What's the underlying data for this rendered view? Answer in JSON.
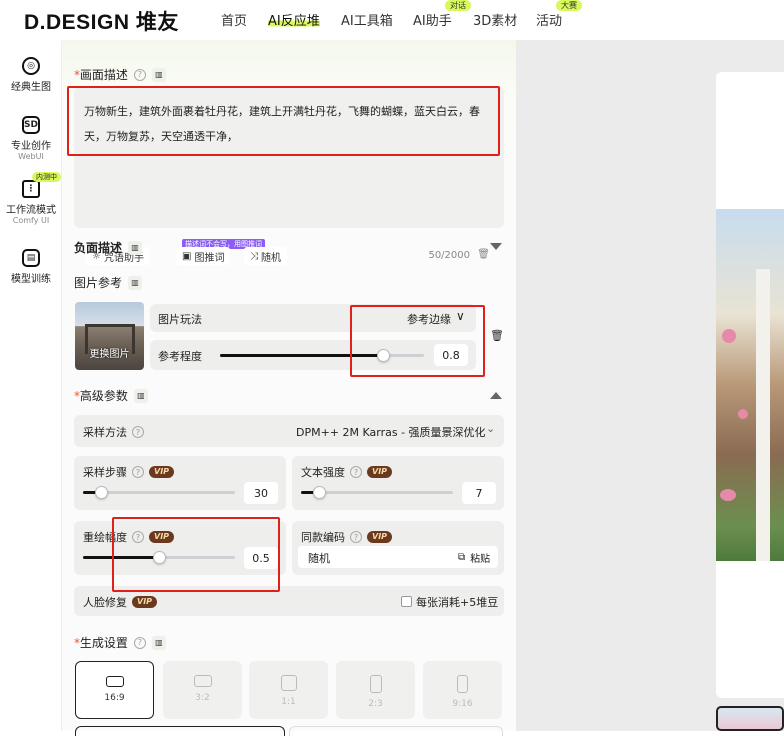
{
  "brand": {
    "logo_text": "D.DESIGN 堆友"
  },
  "nav": {
    "items": [
      {
        "label": "首页"
      },
      {
        "label": "AI反应堆"
      },
      {
        "label": "AI工具箱"
      },
      {
        "label": "AI助手",
        "badge": "对话"
      },
      {
        "label": "3D素材"
      },
      {
        "label": "活动",
        "badge": "大赛"
      }
    ]
  },
  "rail": {
    "items": [
      {
        "label": "经典生图",
        "icon": "palette-icon"
      },
      {
        "label": "专业创作",
        "sub": "WebUI",
        "icon": "sd-icon",
        "icon_text": "SD"
      },
      {
        "label": "工作流模式",
        "sub": "Comfy UI",
        "badge": "内测中",
        "icon": "workflow-icon"
      },
      {
        "label": "模型训练",
        "icon": "model-icon"
      }
    ]
  },
  "prompt": {
    "title": "画面描述",
    "text": "万物新生，建筑外面裹着牡丹花，建筑上开满牡丹花，飞舞的蝴蝶，蓝天白云，春天，万物复苏，天空通透干净，",
    "tools": {
      "assistant": "咒语助手",
      "img2prompt": "图推词",
      "random": "随机",
      "tip": "描述词不会写，用图推词"
    },
    "counter": "50/2000"
  },
  "negative": {
    "title": "负面描述"
  },
  "image_ref": {
    "title": "图片参考",
    "change_label": "更换图片",
    "play_label": "图片玩法",
    "play_value": "参考边缘",
    "strength_label": "参考程度",
    "strength_value": "0.8",
    "strength_fraction": 0.8
  },
  "advanced": {
    "title": "高级参数",
    "sampler_label": "采样方法",
    "sampler_value": "DPM++ 2M Karras - 强质量景深优化",
    "steps_label": "采样步骤",
    "steps_value": "30",
    "steps_fraction": 0.12,
    "cfg_label": "文本强度",
    "cfg_value": "7",
    "cfg_fraction": 0.12,
    "denoise_label": "重绘幅度",
    "denoise_value": "0.5",
    "denoise_fraction": 0.5,
    "seed_label": "同款编码",
    "seed_value": "随机",
    "paste_label": "粘贴",
    "face_label": "人脸修复",
    "face_cost": "每张消耗+5堆豆",
    "vip": "VIP"
  },
  "generate": {
    "title": "生成设置",
    "ratios": [
      "16:9",
      "3:2",
      "1:1",
      "2:3",
      "9:16"
    ]
  },
  "colors": {
    "accent": "#d9f85a",
    "highlight_box": "#e0201a",
    "vip_bg": "#6b3a1e"
  }
}
